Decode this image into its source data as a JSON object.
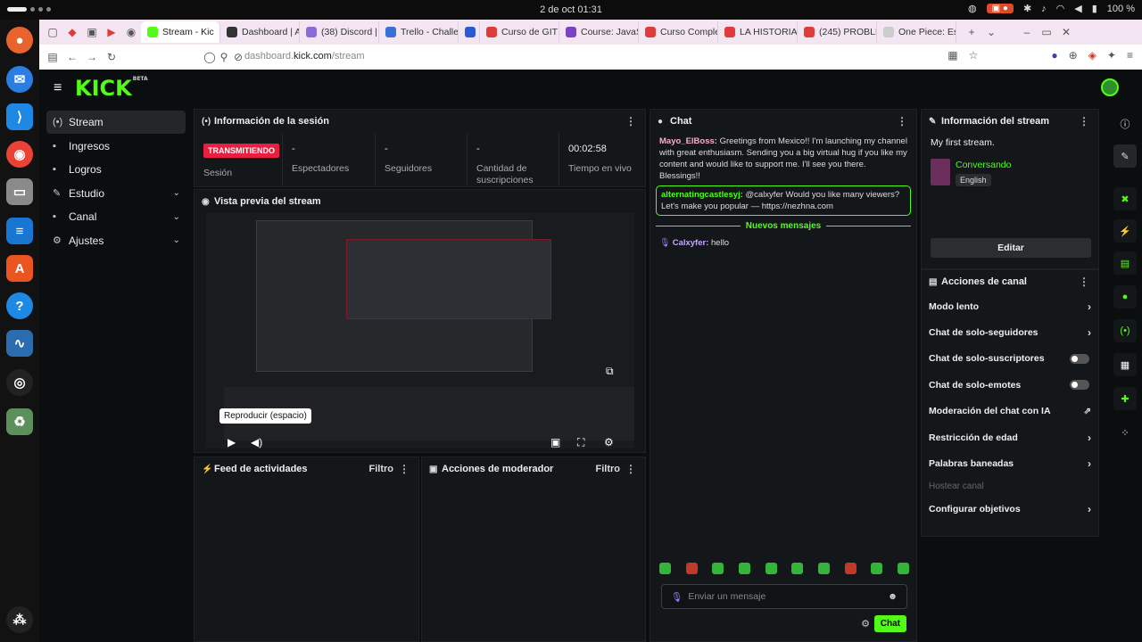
{
  "os": {
    "clock": "2 de oct  01:31",
    "battery": "100 %"
  },
  "browser": {
    "tabs": [
      {
        "label": "Stream - Kic",
        "color": "#53fc18",
        "active": true
      },
      {
        "label": "Dashboard | A",
        "color": "#333333"
      },
      {
        "label": "(38) Discord |",
        "color": "#8a6cd8"
      },
      {
        "label": "Trello - Challe",
        "color": "#3a6fd8"
      },
      {
        "label": "",
        "color": "#2a5bd7"
      },
      {
        "label": "Curso de GIT",
        "color": "#e03b3b"
      },
      {
        "label": "Course: JavaS",
        "color": "#7a43c7"
      },
      {
        "label": "Curso Comple",
        "color": "#e03b3b"
      },
      {
        "label": "LA HISTORIA",
        "color": "#e03b3b"
      },
      {
        "label": "(245) PROBLE",
        "color": "#e03b3b"
      },
      {
        "label": "One Piece: Es",
        "color": "#cccccc"
      }
    ],
    "url_host": "dashboard.",
    "url_domain": "kick.com",
    "url_path": "/stream"
  },
  "header": {
    "logo": "KICK",
    "logo_badge": "BETA"
  },
  "sidebar": {
    "items": [
      {
        "label": "Stream",
        "icon": "broadcast-icon",
        "glyph": "(•)"
      },
      {
        "label": "Ingresos",
        "icon": "dollar-icon",
        "glyph": "▪"
      },
      {
        "label": "Logros",
        "icon": "trophy-icon",
        "glyph": "▪"
      },
      {
        "label": "Estudio",
        "icon": "brush-icon",
        "glyph": "✎"
      },
      {
        "label": "Canal",
        "icon": "user-icon",
        "glyph": "▪"
      },
      {
        "label": "Ajustes",
        "icon": "gear-icon",
        "glyph": "⚙"
      }
    ]
  },
  "session": {
    "title": "Información de la sesión",
    "live_badge": "TRANSMITIENDO",
    "session_label": "Sesión",
    "stats": [
      {
        "value": "-",
        "label": "Espectadores"
      },
      {
        "value": "-",
        "label": "Seguidores"
      },
      {
        "value": "-",
        "label": "Cantidad de suscripciones"
      },
      {
        "value": "00:02:58",
        "label": "Tiempo en vivo"
      }
    ]
  },
  "preview": {
    "title": "Vista previa del stream",
    "tooltip": "Reproducir (espacio)"
  },
  "feed": {
    "title": "Feed de actividades",
    "filter": "Filtro"
  },
  "mod_actions": {
    "title": "Acciones de moderador",
    "filter": "Filtro"
  },
  "chat": {
    "title": "Chat",
    "messages": [
      {
        "user": "Mayo_ElBoss:",
        "user_color": "#f7b0c8",
        "text": " Greetings from Mexico!! I'm launching my channel with great enthusiasm. Sending you a big virtual hug if you like my content and would like to support me. I'll see you there. Blessings!!"
      }
    ],
    "highlight": {
      "user": "alternatingcastlesyj:",
      "user_color": "#53fc18",
      "text": " @calxyfer Would you like many viewers? Let's make you popular — https://nezhna.com"
    },
    "new_messages": "Nuevos mensajes",
    "own": {
      "user": "Calxyfer:",
      "user_color": "#c6a7ff",
      "text": " hello"
    },
    "input_placeholder": "Enviar un mensaje",
    "send": "Chat"
  },
  "stream_info": {
    "title": "Información del stream",
    "stream_title": "My first stream.",
    "category": "Conversando",
    "language": "English",
    "edit": "Editar"
  },
  "channel_actions": {
    "title": "Acciones de canal",
    "rows": [
      {
        "label": "Modo lento",
        "kind": "arrow"
      },
      {
        "label": "Chat de solo-seguidores",
        "kind": "arrow"
      },
      {
        "label": "Chat de solo-suscriptores",
        "kind": "toggle"
      },
      {
        "label": "Chat de solo-emotes",
        "kind": "toggle"
      },
      {
        "label": "Moderación del chat con IA",
        "kind": "external"
      },
      {
        "label": "Restricción de edad",
        "kind": "arrow"
      },
      {
        "label": "Palabras baneadas",
        "kind": "arrow"
      },
      {
        "label": "Hostear canal",
        "kind": "disabled"
      },
      {
        "label": "Configurar objetivos",
        "kind": "arrow"
      }
    ]
  },
  "colors": {
    "brand": "#53fc18",
    "live": "#e91e40",
    "panel": "#141719"
  }
}
